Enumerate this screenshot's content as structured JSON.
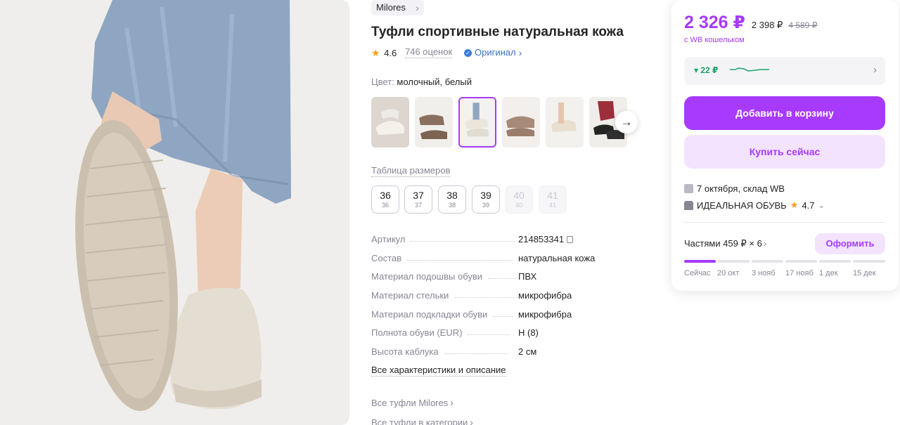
{
  "product": {
    "brand": "Milores",
    "title": "Туфли спортивные натуральная кожа",
    "rating": "4.6",
    "reviews": "746 оценок",
    "original_label": "Оригинал",
    "color_key": "Цвет:",
    "color_value": "молочный, белый",
    "size_table_label": "Таблица размеров",
    "sizes": [
      {
        "size": "36",
        "sub": "36",
        "available": true
      },
      {
        "size": "37",
        "sub": "37",
        "available": true
      },
      {
        "size": "38",
        "sub": "38",
        "available": true
      },
      {
        "size": "39",
        "sub": "39",
        "available": true
      },
      {
        "size": "40",
        "sub": "40",
        "available": false
      },
      {
        "size": "41",
        "sub": "41",
        "available": false
      }
    ],
    "specs": [
      {
        "key": "Артикул",
        "value": "214853341"
      },
      {
        "key": "Состав",
        "value": "натуральная кожа"
      },
      {
        "key": "Материал подошвы обуви",
        "value": "ПВХ"
      },
      {
        "key": "Материал стельки",
        "value": "микрофибра"
      },
      {
        "key": "Материал подкладки обуви",
        "value": "микрофибра"
      },
      {
        "key": "Полнота обуви (EUR)",
        "value": "H (8)"
      },
      {
        "key": "Высота каблука",
        "value": "2 см"
      }
    ],
    "all_specs_link": "Все характеристики и описание",
    "brand_link": "Все туфли Milores",
    "category_link": "Все туфли в категории"
  },
  "purchase": {
    "price": "2 326 ₽",
    "price_regular": "2 398 ₽",
    "price_old": "4 589 ₽",
    "wallet_note": "с WB кошельком",
    "trend_value": "▾ 22 ₽",
    "add_to_cart": "Добавить в корзину",
    "buy_now": "Купить сейчас",
    "delivery": "7 октября, склад WB",
    "seller": "ИДЕАЛЬНАЯ ОБУВЬ",
    "seller_rating": "4.7",
    "installments": "Частями 459 ₽ × 6",
    "installments_button": "Оформить",
    "plan_dates": [
      "Сейчас",
      "20 окт",
      "3 нояб",
      "17 нояб",
      "1 дек",
      "15 дек"
    ],
    "plan_paid_fraction": 0.1667
  },
  "colors": {
    "accent": "#a73afd",
    "accent_light": "#f3e3ff",
    "link_blue": "#3a70c5",
    "trend_green": "#19a366",
    "star": "#ff9a1a"
  },
  "icons": [
    "chevron-right-icon",
    "star-icon",
    "verified-check-icon",
    "arrow-right-icon",
    "copy-icon",
    "box-icon",
    "store-icon",
    "chevron-down-icon"
  ]
}
